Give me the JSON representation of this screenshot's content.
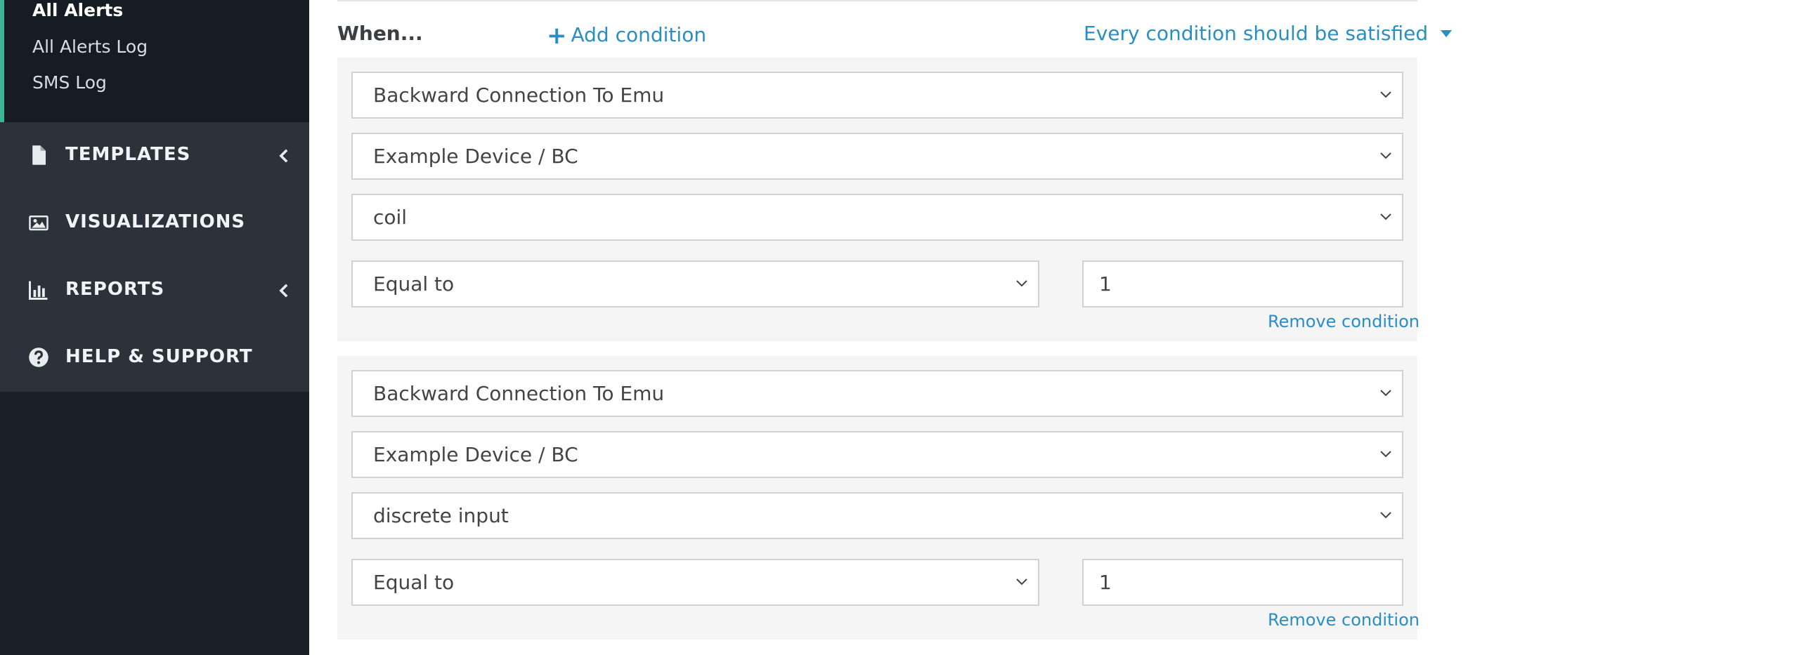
{
  "sidebar": {
    "submenu": [
      "All Alerts",
      "All Alerts Log",
      "SMS Log"
    ],
    "nav": [
      {
        "label": "TEMPLATES",
        "icon": "file-icon",
        "has_chevron": true
      },
      {
        "label": "VISUALIZATIONS",
        "icon": "image-icon",
        "has_chevron": false
      },
      {
        "label": "REPORTS",
        "icon": "bar-chart-icon",
        "has_chevron": true
      },
      {
        "label": "HELP & SUPPORT",
        "icon": "question-circle-icon",
        "has_chevron": false
      }
    ]
  },
  "main": {
    "when_label": "When...",
    "add_condition": "Add condition",
    "satisfy_mode": "Every condition should be satisfied",
    "conditions": [
      {
        "source": "Backward Connection To Emu",
        "device": "Example Device / BC",
        "register": "coil",
        "operator": "Equal to",
        "value": "1",
        "remove_label": "Remove condition"
      },
      {
        "source": "Backward Connection To Emu",
        "device": "Example Device / BC",
        "register": "discrete input",
        "operator": "Equal to",
        "value": "1",
        "remove_label": "Remove condition"
      }
    ]
  },
  "colors": {
    "accent": "#2a8ec6",
    "sidebar_bg": "#1a2028",
    "sidebar_active_border": "#3fb494"
  }
}
